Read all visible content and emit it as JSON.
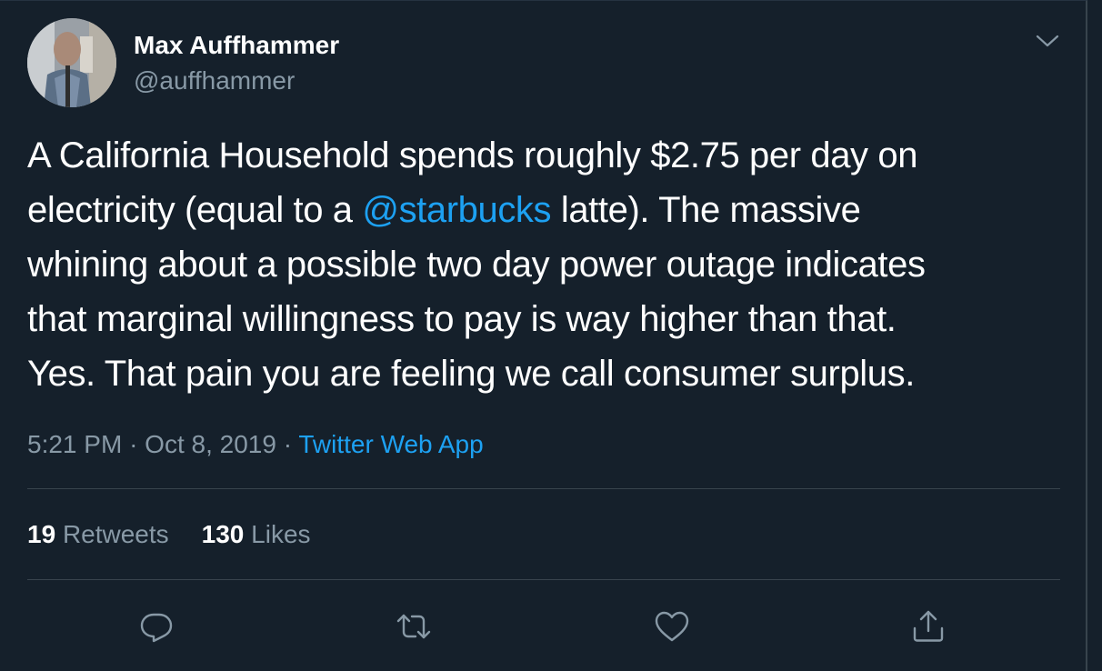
{
  "tweet": {
    "author_name": "Max Auffhammer",
    "author_handle": "@auffhammer",
    "text_lines": [
      {
        "before": "A California Household spends roughly $2.75 per day on"
      },
      {
        "before": "electricity (equal to a ",
        "mention": "@starbucks",
        "after": " latte). The massive"
      },
      {
        "before": "whining about a possible two day power outage indicates"
      },
      {
        "before": "that marginal willingness to pay is way higher than that."
      },
      {
        "before": "Yes. That pain you are feeling we call consumer surplus."
      }
    ],
    "time": "5:21 PM",
    "date": "Oct 8, 2019",
    "separator": "·",
    "source": "Twitter Web App"
  },
  "stats": {
    "retweets_count": "19",
    "retweets_label": "Retweets",
    "likes_count": "130",
    "likes_label": "Likes"
  },
  "actions": [
    {
      "icon": "reply-icon"
    },
    {
      "icon": "retweet-icon"
    },
    {
      "icon": "like-icon"
    },
    {
      "icon": "share-icon"
    }
  ],
  "colors": {
    "background": "#15202b",
    "text": "#ffffff",
    "secondary_text": "#8899a6",
    "link": "#1da1f2",
    "divider": "#38444d"
  }
}
